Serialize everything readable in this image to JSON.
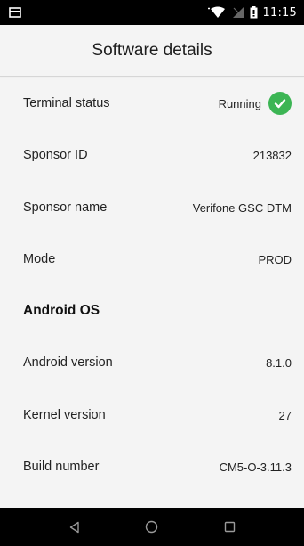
{
  "status_bar": {
    "time": "11:15",
    "icons": [
      "notification-icon",
      "wifi-icon",
      "no-sim-icon",
      "battery-icon"
    ]
  },
  "app_bar": {
    "title": "Software details"
  },
  "rows": [
    {
      "label": "Terminal status",
      "value": "Running",
      "icon": "check-circle-icon",
      "icon_color": "#3cb554"
    },
    {
      "label": "Sponsor ID",
      "value": "213832"
    },
    {
      "label": "Sponsor name",
      "value": "Verifone GSC DTM"
    },
    {
      "label": "Mode",
      "value": "PROD"
    },
    {
      "section": "Android OS"
    },
    {
      "label": "Android version",
      "value": "8.1.0"
    },
    {
      "label": "Kernel version",
      "value": "27"
    },
    {
      "label": "Build number",
      "value": "CM5-O-3.11.3"
    }
  ],
  "nav_bar": {
    "buttons": [
      "back-icon",
      "home-icon",
      "recents-icon"
    ]
  },
  "colors": {
    "background": "#f4f4f4",
    "status_bar": "#000000",
    "nav_bar": "#000000",
    "accent_success": "#3cb554"
  }
}
